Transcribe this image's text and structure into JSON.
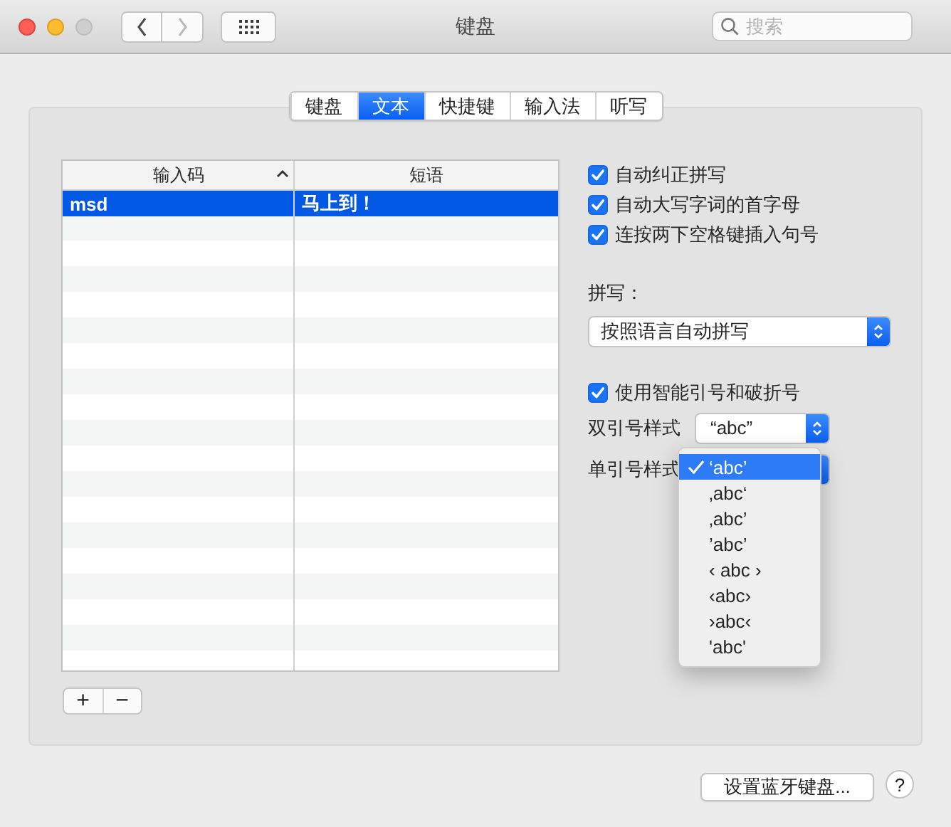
{
  "window": {
    "title": "键盘",
    "search": {
      "placeholder": "搜索"
    }
  },
  "tabs": [
    {
      "label": "键盘",
      "selected": false
    },
    {
      "label": "文本",
      "selected": true
    },
    {
      "label": "快捷键",
      "selected": false
    },
    {
      "label": "输入法",
      "selected": false
    },
    {
      "label": "听写",
      "selected": false
    }
  ],
  "table": {
    "columns": [
      {
        "label": "输入码",
        "sorted": true
      },
      {
        "label": "短语",
        "sorted": false
      }
    ],
    "rows": [
      {
        "cells": [
          "msd",
          "马上到！"
        ],
        "selected": true
      }
    ]
  },
  "table_buttons": [
    "+",
    "−"
  ],
  "options": {
    "checkboxes": [
      {
        "label": "自动纠正拼写",
        "checked": true
      },
      {
        "label": "自动大写字词的首字母",
        "checked": true
      },
      {
        "label": "连按两下空格键插入句号",
        "checked": true
      }
    ],
    "spelling_label": "拼写：",
    "spelling_popup": "按照语言自动拼写",
    "smart_quotes": {
      "label": "使用智能引号和破折号",
      "checked": true
    },
    "double_quotes": {
      "label": "双引号样式",
      "value": "“abc”"
    },
    "single_quotes": {
      "label": "单引号样式",
      "menu": [
        {
          "label": "‘abc’",
          "selected": true
        },
        {
          "label": "‚abc‘",
          "selected": false
        },
        {
          "label": "‚abc’",
          "selected": false
        },
        {
          "label": "’abc’",
          "selected": false
        },
        {
          "label": "‹ abc ›",
          "selected": false
        },
        {
          "label": "‹abc›",
          "selected": false
        },
        {
          "label": "›abc‹",
          "selected": false
        },
        {
          "label": "'abc'",
          "selected": false
        }
      ]
    }
  },
  "footer": {
    "button": "设置蓝牙键盘...",
    "help": "?"
  }
}
